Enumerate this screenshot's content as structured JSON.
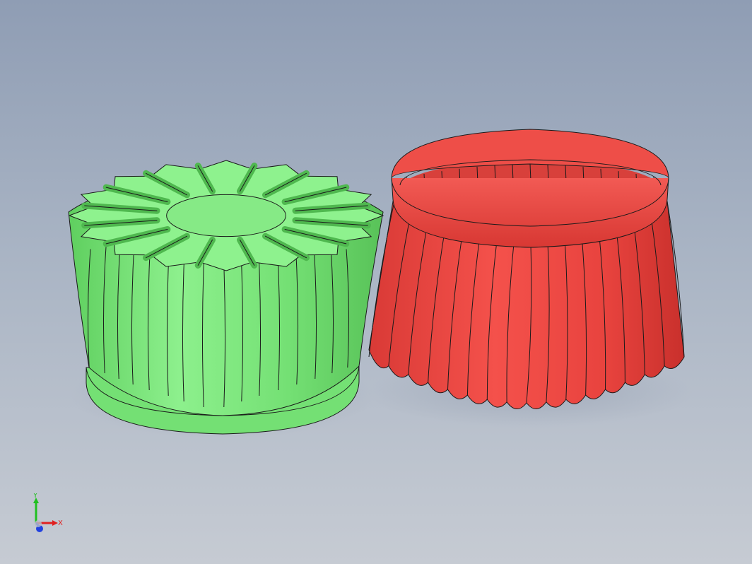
{
  "viewport": {
    "background_top": "#8f9db4",
    "background_bottom": "#c6cbd3"
  },
  "parts": [
    {
      "name": "fluted-core",
      "color": "#7ee67e",
      "flute_count": 16
    },
    {
      "name": "fluted-shell",
      "color": "#ef4a44",
      "flute_count": 16
    }
  ],
  "triad": {
    "x_label": "X",
    "y_label": "Y",
    "x_color": "#e02020",
    "y_color": "#20c020",
    "z_color": "#2040e0"
  }
}
